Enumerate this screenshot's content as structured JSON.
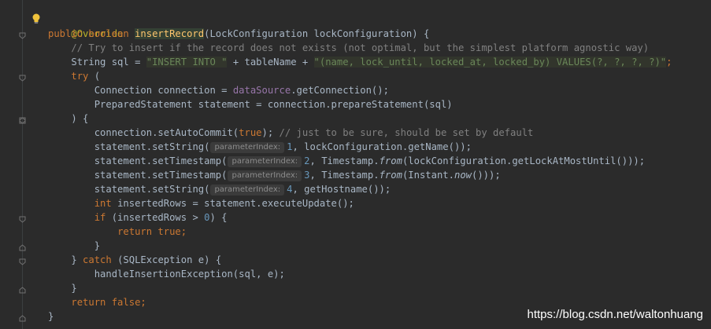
{
  "code": {
    "annotation": "@Override",
    "l2_kw": "public boolean ",
    "l2_method": "insertRecord",
    "l2_rest": "(LockConfiguration lockConfiguration) {",
    "l3_comment": "// Try to insert if the record does not exists (not optimal, but the simplest platform agnostic way)",
    "l4_a": "String sql = ",
    "l4_s1": "\"INSERT INTO \"",
    "l4_b": " + tableName + ",
    "l4_s2": "\"(name, lock_until, locked_at, locked_by) VALUES(?, ?, ?, ?)\"",
    "l4_c": ";",
    "l5_kw": "try ",
    "l5_rest": "(",
    "l6_a": "Connection connection = ",
    "l6_fld": "dataSource",
    "l6_b": ".getConnection();",
    "l7": "PreparedStatement statement = connection.prepareStatement(sql)",
    "l8": ") {",
    "l9_a": "connection.setAutoCommit(",
    "l9_kw": "true",
    "l9_b": "); ",
    "l9_cmt": "// just to be sure, should be set by default",
    "l10_a": "statement.setString(",
    "l10_num": "1",
    "l10_b": ", lockConfiguration.getName());",
    "l11_a": "statement.setTimestamp(",
    "l11_num": "2",
    "l11_b": ", Timestamp.",
    "l11_it": "from",
    "l11_c": "(lockConfiguration.getLockAtMostUntil()));",
    "l12_a": "statement.setTimestamp(",
    "l12_num": "3",
    "l12_b": ", Timestamp.",
    "l12_it": "from",
    "l12_c": "(Instant.",
    "l12_it2": "now",
    "l12_d": "()));",
    "l13_a": "statement.setString(",
    "l13_num": "4",
    "l13_b": ", getHostname());",
    "l14_kw": "int ",
    "l14_rest": "insertedRows = statement.executeUpdate();",
    "l15_kw": "if ",
    "l15_a": "(insertedRows > ",
    "l15_num": "0",
    "l15_b": ") {",
    "l16_kw": "return true",
    "l16_rest": ";",
    "l17": "}",
    "l18_a": "} ",
    "l18_kw": "catch ",
    "l18_b": "(SQLException e) {",
    "l19": "handleInsertionException(sql, e);",
    "l20": "}",
    "l21_kw": "return false",
    "l21_rest": ";",
    "l22": "}"
  },
  "hint_label": "parameterIndex:",
  "watermark": "https://blog.csdn.net/waltonhuang",
  "colors": {
    "background": "#2b2b2b",
    "keyword": "#cc7832",
    "string": "#6a8759",
    "comment": "#808080",
    "method": "#ffc66d",
    "field": "#9876aa",
    "number": "#6897bb",
    "annotation": "#bbb529"
  },
  "icons": [
    "lightbulb-icon",
    "fold-icon"
  ]
}
